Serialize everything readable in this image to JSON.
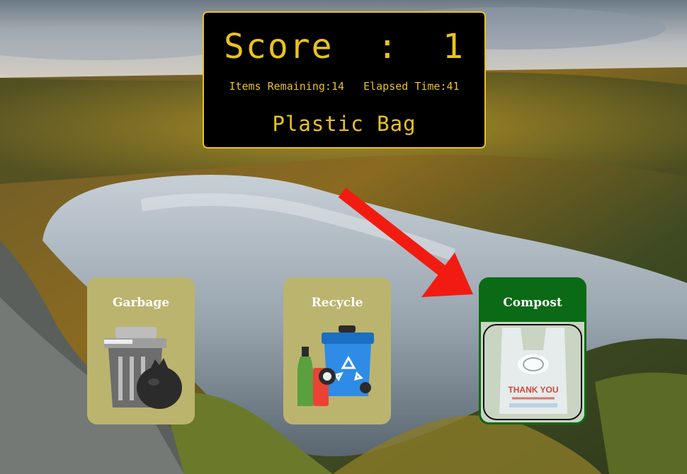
{
  "scoreboard": {
    "score_label": "Score",
    "score_sep": ":",
    "score_value": "1",
    "items_remaining_label": "Items Remaining:",
    "items_remaining_value": "14",
    "elapsed_label": "Elapsed Time:",
    "elapsed_value": "41",
    "current_item": "Plastic Bag"
  },
  "bins": [
    {
      "label": "Garbage",
      "icon": "garbage-bin-icon",
      "color": "#bbb46f"
    },
    {
      "label": "Recycle",
      "icon": "recycle-bin-icon",
      "color": "#bbb46f"
    },
    {
      "label": "Compost",
      "icon": "plastic-bag-item-icon",
      "color": "#0b6a16"
    }
  ],
  "item_card": {
    "bag_text": "THANK YOU"
  },
  "colors": {
    "display_text": "#e8c31f",
    "arrow": "#f21b12",
    "selected_bin": "#0b6a16"
  }
}
